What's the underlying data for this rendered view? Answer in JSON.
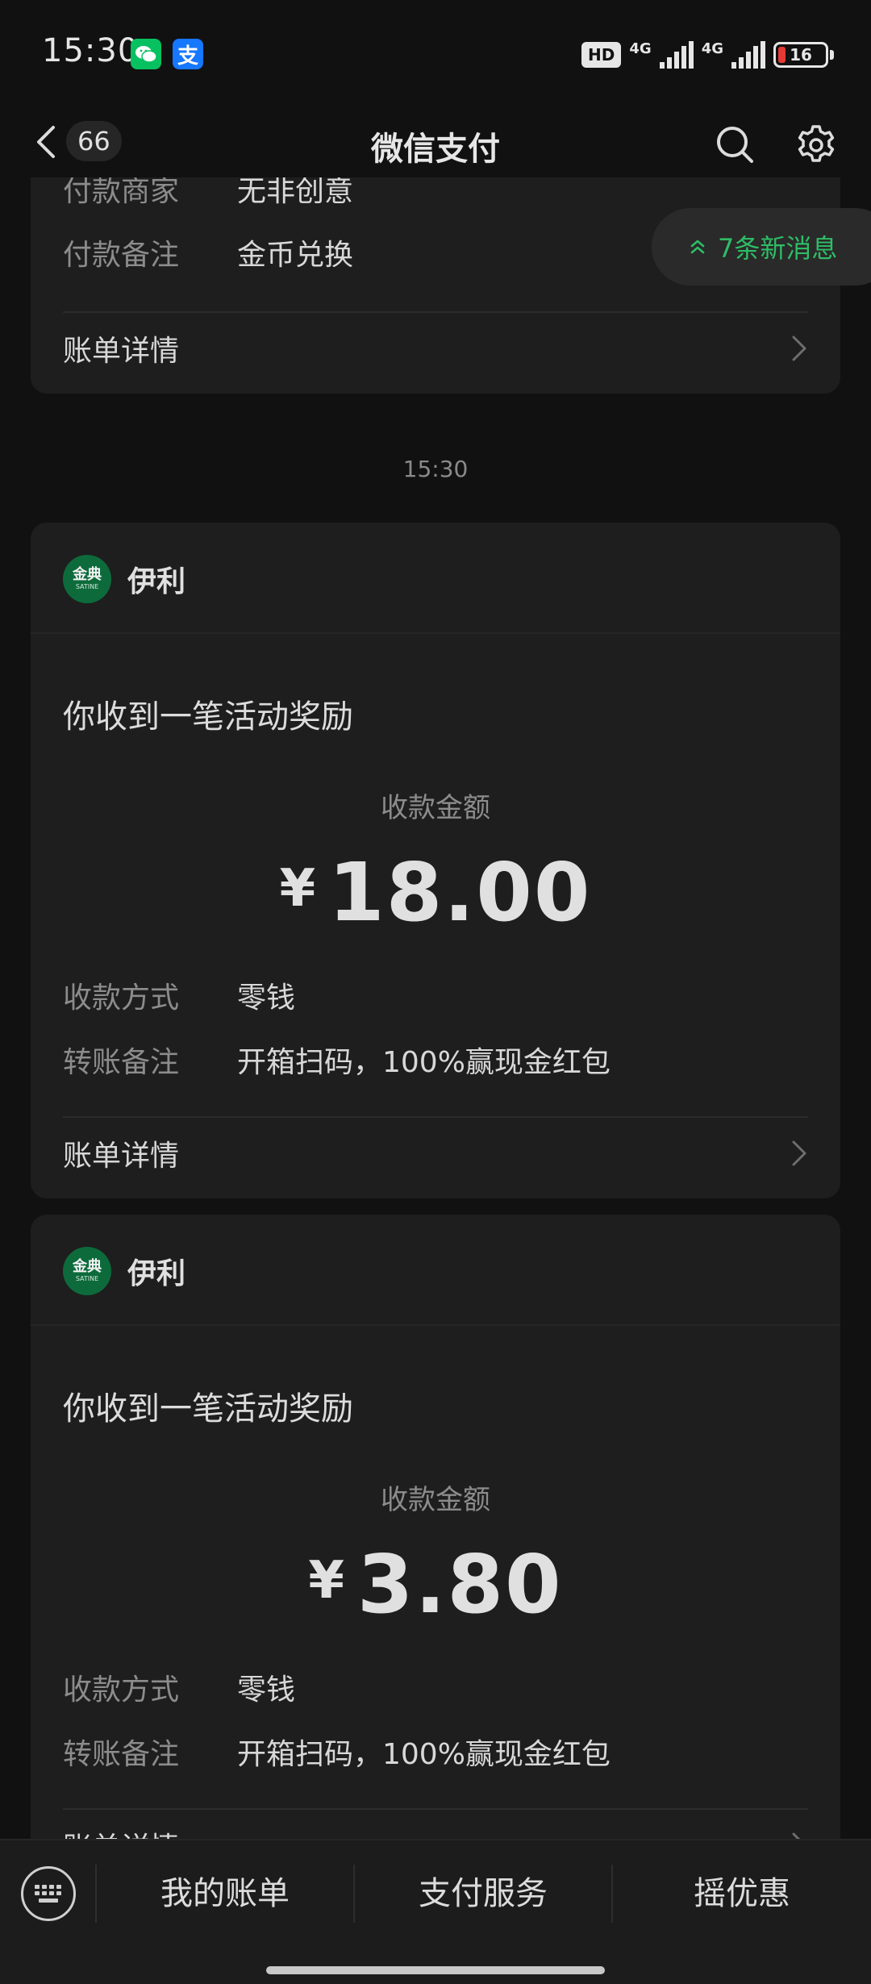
{
  "status_bar": {
    "time": "15:30",
    "hd": "HD",
    "network_1": "4G",
    "network_2": "4G",
    "battery_level": "16",
    "battery_fraction": 0.16
  },
  "nav": {
    "unread_count": "66",
    "title": "微信支付"
  },
  "new_messages": "7条新消息",
  "first_card": {
    "merchant_label": "付款商家",
    "merchant_value": "无非创意",
    "note_label": "付款备注",
    "note_value": "金币兑换",
    "details_label": "账单详情"
  },
  "timestamp": "15:30",
  "cards": [
    {
      "merchant_logo_text": "金典",
      "merchant_logo_sub": "SATINE",
      "merchant_name": "伊利",
      "title": "你收到一笔活动奖励",
      "amount_label": "收款金额",
      "currency": "¥",
      "amount": "18.00",
      "method_label": "收款方式",
      "method_value": "零钱",
      "note_label": "转账备注",
      "note_value": "开箱扫码，100%赢现金红包",
      "details_label": "账单详情"
    },
    {
      "merchant_logo_text": "金典",
      "merchant_logo_sub": "SATINE",
      "merchant_name": "伊利",
      "title": "你收到一笔活动奖励",
      "amount_label": "收款金额",
      "currency": "¥",
      "amount": "3.80",
      "method_label": "收款方式",
      "method_value": "零钱",
      "note_label": "转账备注",
      "note_value": "开箱扫码，100%赢现金红包",
      "details_label": "账单详情"
    }
  ],
  "bottom_menu": {
    "items": [
      "我的账单",
      "支付服务",
      "摇优惠"
    ]
  },
  "colors": {
    "background": "#111111",
    "card": "#1e1e1e",
    "accent_green": "#2ebd66",
    "wechat_green": "#07c160",
    "alipay_blue": "#1677ff",
    "battery_low": "#e53935"
  },
  "icons": {
    "back": "chevron-left-icon",
    "search": "search-icon",
    "settings": "gear-icon",
    "details": "chevron-right-icon",
    "new_messages": "double-chevron-up-icon",
    "keyboard": "keyboard-icon"
  }
}
